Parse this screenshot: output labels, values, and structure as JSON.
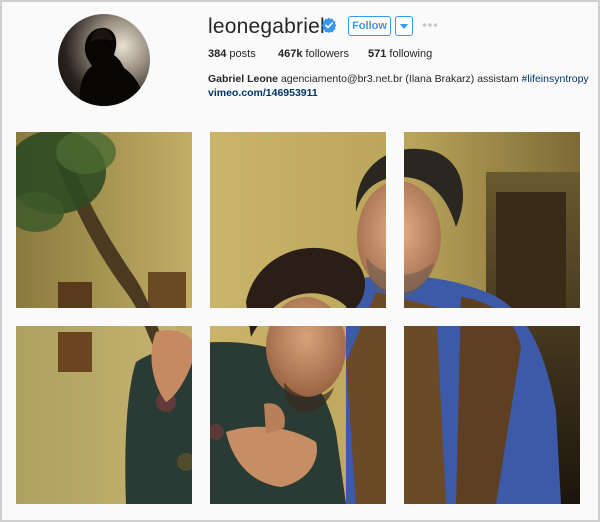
{
  "profile": {
    "username": "leonegabriel",
    "follow_label": "Follow",
    "stats": {
      "posts_count": "384",
      "posts_label": "posts",
      "followers_count": "467k",
      "followers_label": "followers",
      "following_count": "571",
      "following_label": "following"
    },
    "bio": {
      "name": "Gabriel Leone",
      "text": " agenciamento@br3.net.br (Ilana Brakarz) assistam ",
      "hashtag": "#lifeinsyntropy",
      "link": "vimeo.com/146953911"
    }
  },
  "icons": {
    "verified": "verified-badge-icon",
    "dropdown": "chevron-down-icon",
    "more": "more-options-icon"
  },
  "colors": {
    "accent": "#3897f0",
    "link": "#003569",
    "text": "#262626",
    "muted": "#999999"
  },
  "grid": {
    "tiles": [
      {
        "label": "post-1"
      },
      {
        "label": "post-2"
      },
      {
        "label": "post-3"
      },
      {
        "label": "post-4"
      },
      {
        "label": "post-5"
      },
      {
        "label": "post-6"
      }
    ]
  }
}
